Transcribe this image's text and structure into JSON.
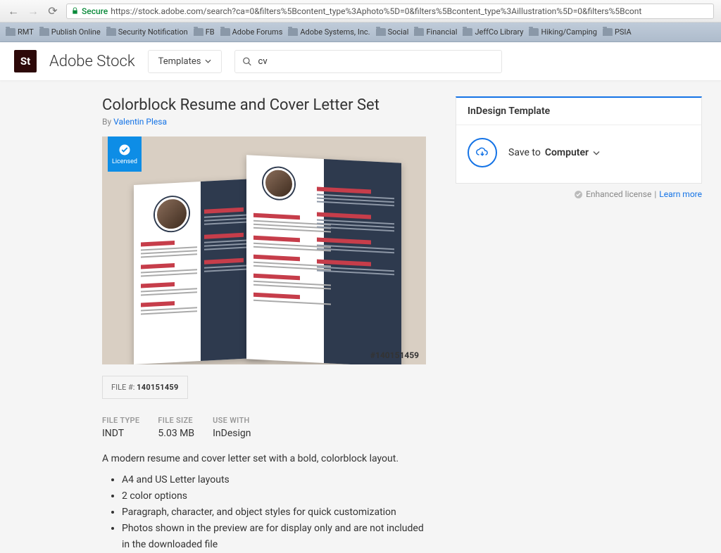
{
  "browser": {
    "secure_label": "Secure",
    "url": "https://stock.adobe.com/search?ca=0&filters%5Bcontent_type%3Aphoto%5D=0&filters%5Bcontent_type%3Aillustration%5D=0&filters%5Bcont"
  },
  "bookmarks": [
    "RMT",
    "Publish Online",
    "Security Notification",
    "FB",
    "Adobe Forums",
    "Adobe Systems, Inc.",
    "Social",
    "Financial",
    "JeffCo Library",
    "Hiking/Camping",
    "PSIA"
  ],
  "header": {
    "logo_abbrev": "St",
    "logo_text": "Adobe Stock",
    "category": "Templates",
    "search_value": "cv"
  },
  "product": {
    "title": "Colorblock Resume and Cover Letter Set",
    "by": "By ",
    "author": "Valentin Plesa",
    "licensed_label": "Licensed",
    "asset_id_display": "#140151459",
    "file_label": "FILE #:",
    "file_number": "140151459",
    "meta": {
      "type_h": "FILE TYPE",
      "type_v": "INDT",
      "size_h": "FILE SIZE",
      "size_v": "5.03 MB",
      "app_h": "USE WITH",
      "app_v": "InDesign"
    },
    "description": "A modern resume and cover letter set with a bold, colorblock layout.",
    "bullets": [
      "A4 and US Letter layouts",
      "2 color options",
      "Paragraph, character, and object styles for quick customization",
      "Photos shown in the preview are for display only and are not included in the downloaded file"
    ]
  },
  "panel": {
    "heading": "InDesign Template",
    "save_prefix": "Save to",
    "save_target": "Computer"
  },
  "license": {
    "text": "Enhanced license",
    "sep": " | ",
    "link": "Learn more"
  }
}
